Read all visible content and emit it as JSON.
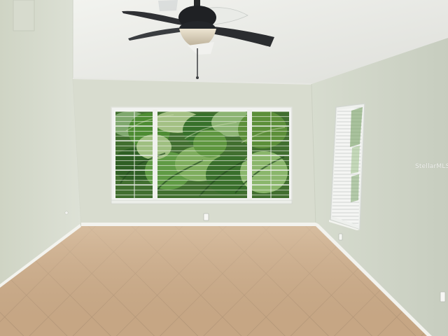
{
  "photo": {
    "watermark": "StellarMLS",
    "colors": {
      "wall": "#d8dccf",
      "ceiling": "#edeeea",
      "floor": "#c9aa88",
      "grout": "#ae9275",
      "trim": "#f3f3ee",
      "foliage": "#3f7d2c",
      "fan_body": "#1d1f22",
      "fan_blade": "#35383c",
      "fan_light": "#d9d2bf"
    },
    "icons": [
      "ceiling-fan-icon",
      "window-blinds-icon",
      "electrical-outlet-icon"
    ]
  }
}
